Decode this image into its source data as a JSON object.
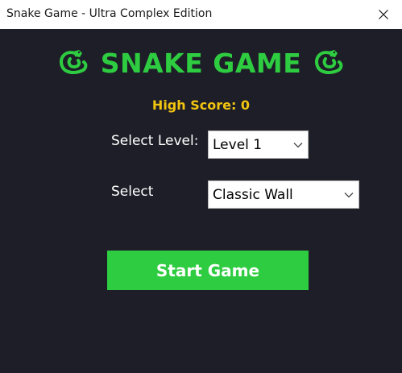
{
  "window": {
    "title": "Snake Game - Ultra Complex Edition",
    "close_icon": "close-icon",
    "background": "#1e1e28"
  },
  "header": {
    "title": "SNAKE GAME",
    "left_icon": "snake-icon",
    "right_icon": "snake-icon",
    "color": "#2ecc40"
  },
  "high_score": {
    "text": "High Score: 0",
    "color": "#f1c40f"
  },
  "level": {
    "label": "Select Level:",
    "selected": "Level 1"
  },
  "mode": {
    "label": "Select",
    "selected": "Classic Wall"
  },
  "start_button": {
    "label": "Start Game",
    "color": "#2ecc40"
  }
}
